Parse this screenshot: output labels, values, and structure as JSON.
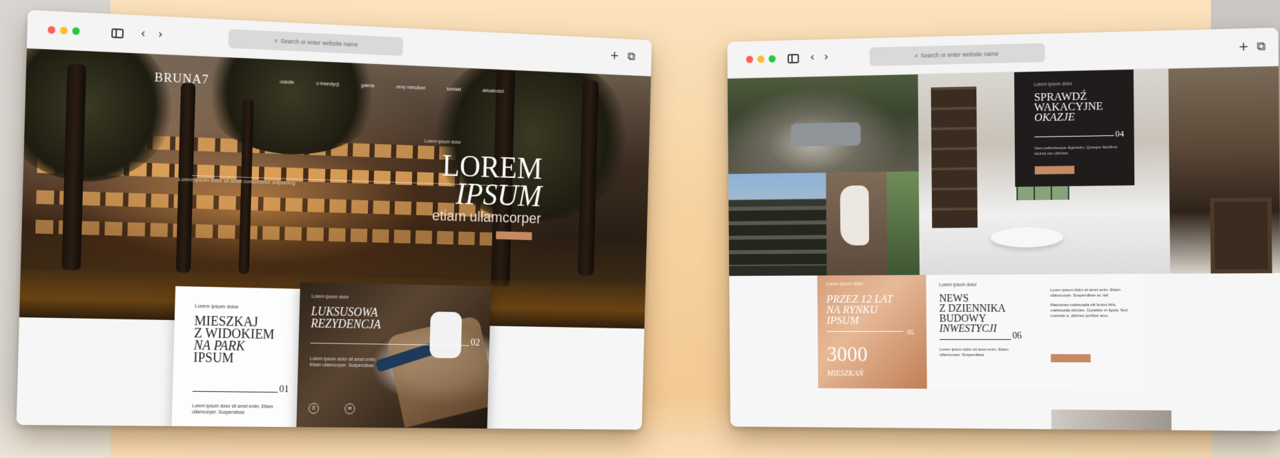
{
  "browser_chrome": {
    "url_placeholder": "Search or enter website name",
    "back_glyph": "‹",
    "forward_glyph": "›",
    "new_tab_glyph": "+",
    "tabs_glyph": "⧉",
    "search_glyph": "⌕"
  },
  "left_site": {
    "logo": "BRUNA7",
    "nav_items": [
      "osiedle",
      "o inwestycji",
      "galeria",
      "ceny mieszkań",
      "kontakt",
      "aktualności"
    ],
    "hero": {
      "kicker": "Lorem ipsum dolor",
      "title_line1": "LOREM",
      "title_line2": "IPSUM",
      "subtitle": "etiam ullamcorper",
      "rule_label": "Lorem ipsum dolor sit amet consectetur adipiscing"
    },
    "card": {
      "kicker": "Lorem ipsum dolor",
      "title_line1": "MIESZKAJ",
      "title_line2": "Z WIDOKIEM",
      "title_line3": "NA PARK",
      "title_line4": "IPSUM",
      "number": "01",
      "body": "Lorem ipsum dolor sit amet enim. Etiam ullamcorper. Suspendisse"
    },
    "photo_card": {
      "kicker": "Lorem ipsum dolor",
      "title_line1": "LUKSUSOWA",
      "title_line2": "REZYDENCJA",
      "number": "02",
      "body": "Lorem ipsum dolor sit amet enim. Etiam ullamcorper. Suspendisse",
      "icons": [
        "phone-icon",
        "message-icon"
      ]
    }
  },
  "right_site": {
    "promo": {
      "kicker": "Lorem ipsum dolor",
      "title_line1": "SPRAWDŹ",
      "title_line2": "WAKACYJNE",
      "title_line3": "OKAZJE",
      "number": "04",
      "body": "Nam pellentesque dignissim. Quisque faucibus lacinia nec ultricies."
    },
    "copper": {
      "kicker": "Lorem ipsum dolor",
      "title_line1": "PRZEZ 12 LAT",
      "title_line2": "NA RYNKU",
      "title_line3": "IPSUM",
      "number": "05",
      "big_value": "3000",
      "big_label": "MIESZKAŃ"
    },
    "news": {
      "kicker": "Lorem ipsum dolor",
      "title_line1": "NEWS",
      "title_line2": "Z DZIENNIKA",
      "title_line3": "BUDOWY",
      "title_line4": "INWESTYCJI",
      "number": "06",
      "body": "Lorem ipsum dolor sit amet enim. Etiam ullamcorper. Suspendisse",
      "col2_p1": "Lorem ipsum dolor sit amet enim. Etiam ullamcorper. Suspendisse ac nisl.",
      "col2_p2": "Maecenas malesuada elit lectus felis, malesuada ultricies. Curabitur et ligula. Sed molestie a, ultricies porttitor arcu."
    }
  },
  "colors": {
    "accent_copper": "#c58a62",
    "dark_panel": "#201c1c",
    "background_warm": "#f5d8ac"
  }
}
